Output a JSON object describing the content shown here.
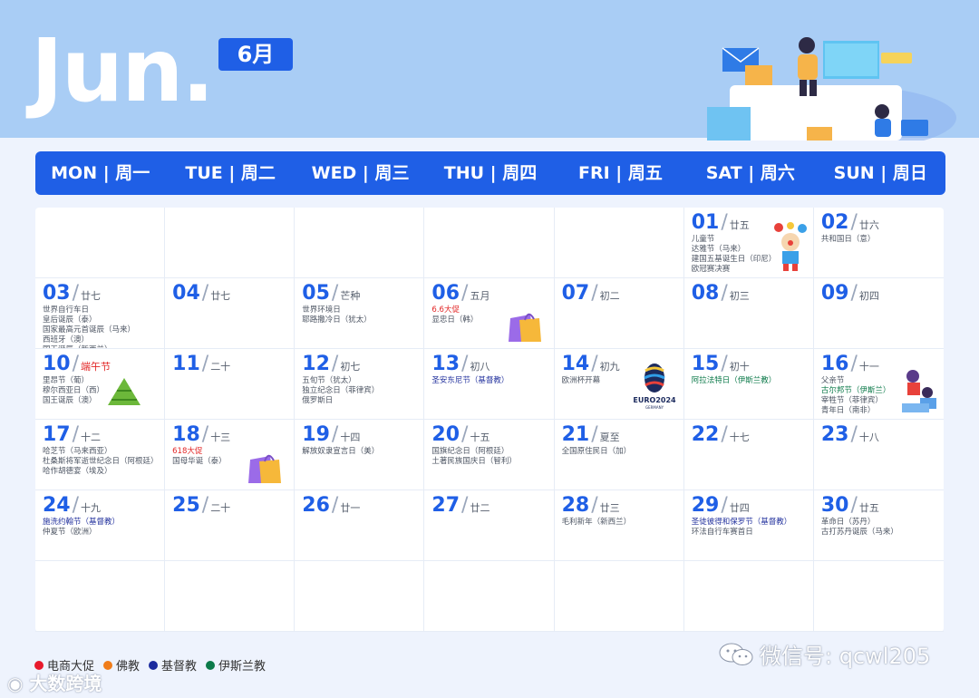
{
  "header": {
    "month_en": "Jun.",
    "month_cn": "6月"
  },
  "weekdays": [
    "MON | 周一",
    "TUE | 周二",
    "WED | 周三",
    "THU | 周四",
    "FRI | 周五",
    "SAT | 周六",
    "SUN | 周日"
  ],
  "days": [
    {
      "day": "01",
      "lunar": "廿五",
      "events": [
        {
          "t": "儿童节"
        },
        {
          "t": "达雅节（马来）"
        },
        {
          "t": "建国五基诞生日（印尼）"
        },
        {
          "t": "欧冠赛决赛"
        }
      ],
      "icon": "clown-icon"
    },
    {
      "day": "02",
      "lunar": "廿六",
      "events": [
        {
          "t": "共和国日（意）"
        }
      ]
    },
    {
      "day": "03",
      "lunar": "廿七",
      "events": [
        {
          "t": "世界自行车日"
        },
        {
          "t": "皇后诞辰（泰）"
        },
        {
          "t": "国家最高元首诞辰（马来）"
        },
        {
          "t": "西班牙（澳）"
        },
        {
          "t": "国王诞辰（新西兰）"
        }
      ]
    },
    {
      "day": "04",
      "lunar": "廿七",
      "events": []
    },
    {
      "day": "05",
      "lunar": "芒种",
      "events": [
        {
          "t": "世界环境日"
        },
        {
          "t": "耶路撒冷日（犹太）"
        }
      ]
    },
    {
      "day": "06",
      "lunar": "五月",
      "events": [
        {
          "t": "6.6大促",
          "k": "ecom"
        },
        {
          "t": "显忠日（韩）"
        }
      ],
      "icon": "shopping-bag-icon"
    },
    {
      "day": "07",
      "lunar": "初二",
      "events": []
    },
    {
      "day": "08",
      "lunar": "初三",
      "events": []
    },
    {
      "day": "09",
      "lunar": "初四",
      "events": []
    },
    {
      "day": "10",
      "lunar": "端午节",
      "lunar_red": true,
      "events": [
        {
          "t": "里昂节（葡）"
        },
        {
          "t": "穆尔西亚日（西）"
        },
        {
          "t": "国王诞辰（澳）"
        }
      ],
      "icon": "zongzi-icon"
    },
    {
      "day": "11",
      "lunar": "二十",
      "events": []
    },
    {
      "day": "12",
      "lunar": "初七",
      "events": [
        {
          "t": "五旬节（犹太）"
        },
        {
          "t": "独立纪念日（菲律宾）"
        },
        {
          "t": "俄罗斯日"
        }
      ]
    },
    {
      "day": "13",
      "lunar": "初八",
      "events": [
        {
          "t": "圣安东尼节（基督教）",
          "k": "christ"
        }
      ]
    },
    {
      "day": "14",
      "lunar": "初九",
      "events": [
        {
          "t": "欧洲杯开幕"
        }
      ],
      "icon": "euro2024-logo",
      "logo_text": "EURO2024",
      "logo_sub": "GERMANY"
    },
    {
      "day": "15",
      "lunar": "初十",
      "events": [
        {
          "t": "阿拉法特日（伊斯兰教）",
          "k": "islam"
        }
      ]
    },
    {
      "day": "16",
      "lunar": "十一",
      "events": [
        {
          "t": "父亲节"
        },
        {
          "t": "古尔邦节（伊斯兰）",
          "k": "islam"
        },
        {
          "t": "宰牲节（菲律宾）"
        },
        {
          "t": "青年日（南非）"
        }
      ],
      "icon": "father-child-icon"
    },
    {
      "day": "17",
      "lunar": "十二",
      "events": [
        {
          "t": "哈芝节（马来西亚）"
        },
        {
          "t": "杜桑斯将军逝世纪念日（阿根廷）"
        },
        {
          "t": "哈作胡德宴（埃及）"
        }
      ]
    },
    {
      "day": "18",
      "lunar": "十三",
      "events": [
        {
          "t": "618大促",
          "k": "ecom"
        },
        {
          "t": "国母华诞（泰）"
        }
      ],
      "icon": "shopping-bag-icon"
    },
    {
      "day": "19",
      "lunar": "十四",
      "events": [
        {
          "t": "解放奴隶宣言日（美）"
        }
      ]
    },
    {
      "day": "20",
      "lunar": "十五",
      "events": [
        {
          "t": "国旗纪念日（阿根廷）"
        },
        {
          "t": "土著民族国庆日（智利）"
        }
      ]
    },
    {
      "day": "21",
      "lunar": "夏至",
      "events": [
        {
          "t": "全国原住民日（加）"
        }
      ]
    },
    {
      "day": "22",
      "lunar": "十七",
      "events": []
    },
    {
      "day": "23",
      "lunar": "十八",
      "events": []
    },
    {
      "day": "24",
      "lunar": "十九",
      "events": [
        {
          "t": "施洗约翰节（基督教）",
          "k": "christ"
        },
        {
          "t": "仲夏节（欧洲）"
        }
      ]
    },
    {
      "day": "25",
      "lunar": "二十",
      "events": []
    },
    {
      "day": "26",
      "lunar": "廿一",
      "events": []
    },
    {
      "day": "27",
      "lunar": "廿二",
      "events": []
    },
    {
      "day": "28",
      "lunar": "廿三",
      "events": [
        {
          "t": "毛利新年（新西兰）"
        }
      ]
    },
    {
      "day": "29",
      "lunar": "廿四",
      "events": [
        {
          "t": "圣徒彼得和保罗节（基督教）",
          "k": "christ"
        },
        {
          "t": "环法自行车赛首日"
        }
      ]
    },
    {
      "day": "30",
      "lunar": "廿五",
      "events": [
        {
          "t": "革命日（苏丹）"
        },
        {
          "t": "古打苏丹诞辰（马来）"
        }
      ]
    }
  ],
  "leading_blanks": 5,
  "legend": [
    {
      "label": "电商大促",
      "color": "#e8192c"
    },
    {
      "label": "佛教",
      "color": "#f07d1a"
    },
    {
      "label": "基督教",
      "color": "#1a2a9e"
    },
    {
      "label": "伊斯兰教",
      "color": "#0c7a4a"
    }
  ],
  "colors": {
    "accent": "#1f5fe6",
    "header_band": "#a9cdf5",
    "ecom": "#e22626",
    "christian": "#23329e",
    "islam": "#0c7a4a"
  },
  "watermark_left": "大数跨境",
  "watermark_right": "微信号: qcwl205"
}
